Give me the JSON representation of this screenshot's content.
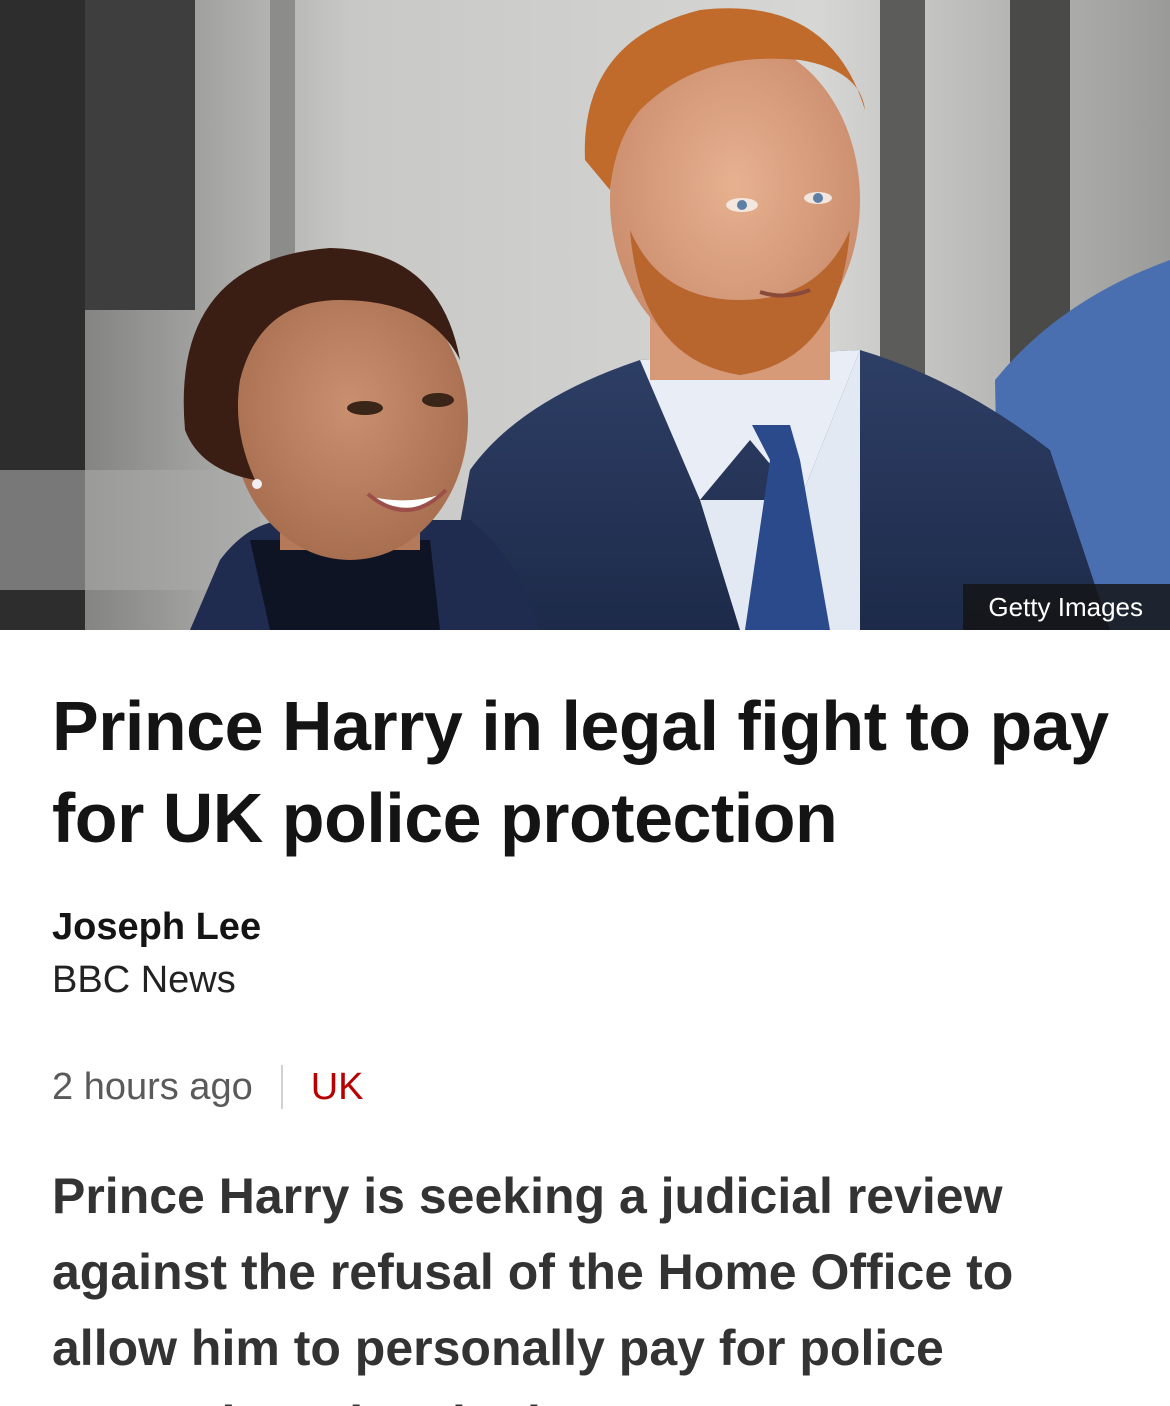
{
  "hero": {
    "alt": "Prince Harry and Meghan",
    "credit": "Getty Images"
  },
  "article": {
    "headline": "Prince Harry in legal fight to pay for UK police protection",
    "author": "Joseph Lee",
    "outlet": "BBC News",
    "timestamp": "2 hours ago",
    "section": "UK",
    "lede": "Prince Harry is seeking a judicial review against the refusal of the Home Office to allow him to personally pay for police protection when in the UK."
  },
  "colors": {
    "section": "#b80000",
    "text": "#141414"
  }
}
